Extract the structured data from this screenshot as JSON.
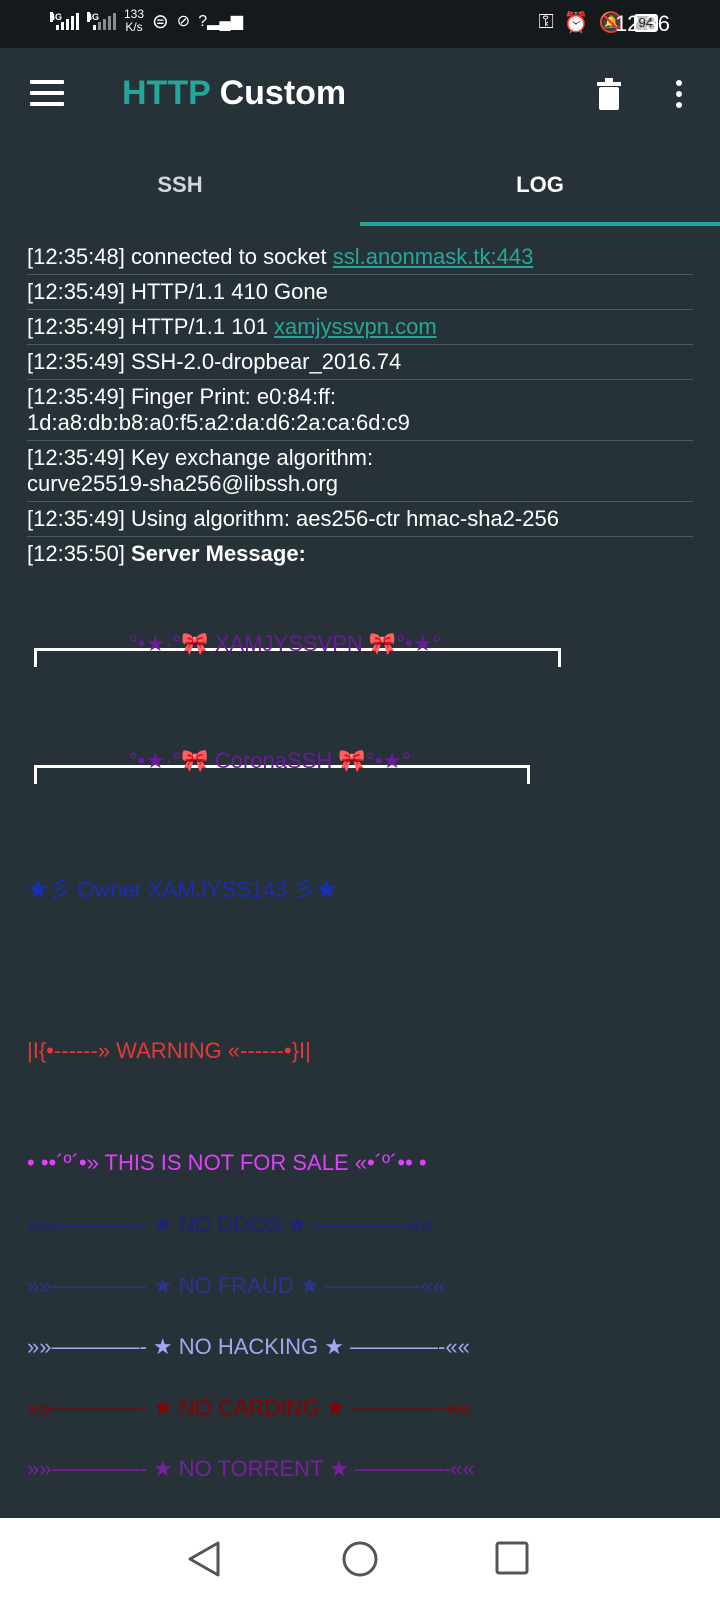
{
  "status_bar": {
    "net1": "4G",
    "net2": "4G",
    "speed_value": "133",
    "speed_unit": "K/s",
    "battery": "94",
    "time": "12:36"
  },
  "app": {
    "title_part1": "HTTP",
    "title_part2": "Custom",
    "accent_color": "#26a69a"
  },
  "tabs": [
    {
      "label": "SSH",
      "active": false
    },
    {
      "label": "LOG",
      "active": true
    }
  ],
  "log": {
    "entries": [
      {
        "prefix": "[12:35:48] connected to socket ",
        "link": "ssl.anonmask.tk:443"
      },
      {
        "text": "[12:35:49] HTTP/1.1 410 Gone"
      },
      {
        "prefix": "[12:35:49] HTTP/1.1 101 ",
        "link": "xamjyssvpn.com"
      },
      {
        "text": "[12:35:49] SSH-2.0-dropbear_2016.74"
      },
      {
        "text": "[12:35:49] Finger Print: e0:84:ff:\n1d:a8:db:b8:a0:f5:a2:da:d6:2a:ca:6d:c9"
      },
      {
        "text": "[12:35:49] Key exchange algorithm:\ncurve25519-sha256@libssh.org"
      },
      {
        "text": "[12:35:49] Using algorithm: aes256-ctr hmac-sha2-256"
      }
    ],
    "server_time": "[12:35:50]",
    "server_label": "Server Message:"
  },
  "server_message": {
    "frame1": "°•★·°🎀 XAMJYSSVPN 🎀°•★°",
    "frame2": "°•★·°🎀 CoronaSSH 🎀°•★°",
    "owner": "★彡 Owner XAMJYSS143 彡★",
    "warning": "|I{•------» WARNING «------•}I|",
    "not_for_sale": "• ••´º´•» THIS IS NOT FOR SALE «•´º´•• •",
    "rules": [
      {
        "text": "»»————- ★ NO DDOS ★ ————-««",
        "color": "#1a237e"
      },
      {
        "text": "»»————- ★ NO FRAUD ★ ————-««",
        "color": "#283593"
      },
      {
        "text": "»»————- ★ NO HACKING ★ ————-««",
        "color": "#9fa8f0"
      },
      {
        "text": "»»————- ★ NO CARDING ★ ————-««",
        "color": "#8b0000"
      },
      {
        "text": "»»————- ★ NO TORRENT ★ ————-««",
        "color": "#7b1fa2"
      }
    ]
  }
}
